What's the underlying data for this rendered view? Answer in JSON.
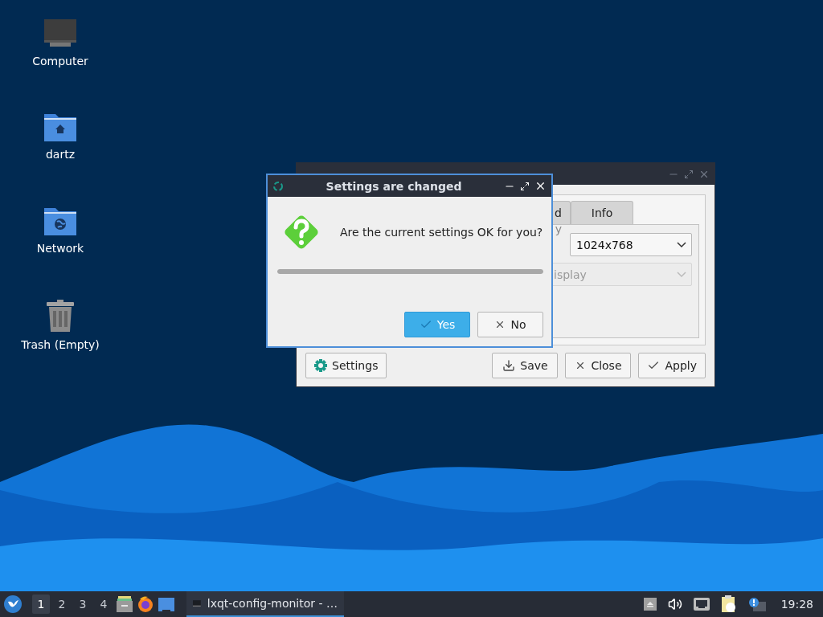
{
  "desktop_icons": [
    {
      "label": "Computer",
      "kind": "computer"
    },
    {
      "label": "dartz",
      "kind": "home"
    },
    {
      "label": "Network",
      "kind": "network"
    },
    {
      "label": "Trash (Empty)",
      "kind": "trash"
    }
  ],
  "main_window": {
    "tabs": [
      {
        "label": "d",
        "selected": false
      },
      {
        "label": "Info",
        "selected": false
      }
    ],
    "fields": [
      {
        "label": "y",
        "value": "1024x768",
        "disabled": false
      },
      {
        "value": "isplay",
        "disabled": true
      }
    ],
    "buttons": [
      {
        "label": "Settings",
        "kind": "gear"
      },
      {
        "label": "Save",
        "kind": "download"
      },
      {
        "label": "Close",
        "kind": "close"
      },
      {
        "label": "Apply",
        "kind": "check"
      }
    ]
  },
  "dialog": {
    "title": "Settings are changed",
    "message": "Are the current settings OK for you?",
    "progress": {
      "level": 1
    },
    "buttons": [
      {
        "label": "Yes",
        "kind": "check",
        "focused": true
      },
      {
        "label": "No",
        "kind": "close",
        "focused": false
      }
    ]
  },
  "taskbar": {
    "workspaces": [
      {
        "label": "1",
        "selected": true
      },
      {
        "label": "2",
        "selected": false
      },
      {
        "label": "3",
        "selected": false
      },
      {
        "label": "4",
        "selected": false
      }
    ],
    "launchers": [
      {
        "kind": "files"
      },
      {
        "kind": "browser"
      },
      {
        "kind": "desktop"
      }
    ],
    "tasks": [
      {
        "label": "lxqt-config-monitor - …",
        "selected": true
      }
    ],
    "tray": [
      {
        "kind": "eject"
      },
      {
        "kind": "volume"
      },
      {
        "kind": "network"
      },
      {
        "kind": "clipboard"
      },
      {
        "kind": "notification"
      }
    ],
    "clock": "19:28"
  }
}
